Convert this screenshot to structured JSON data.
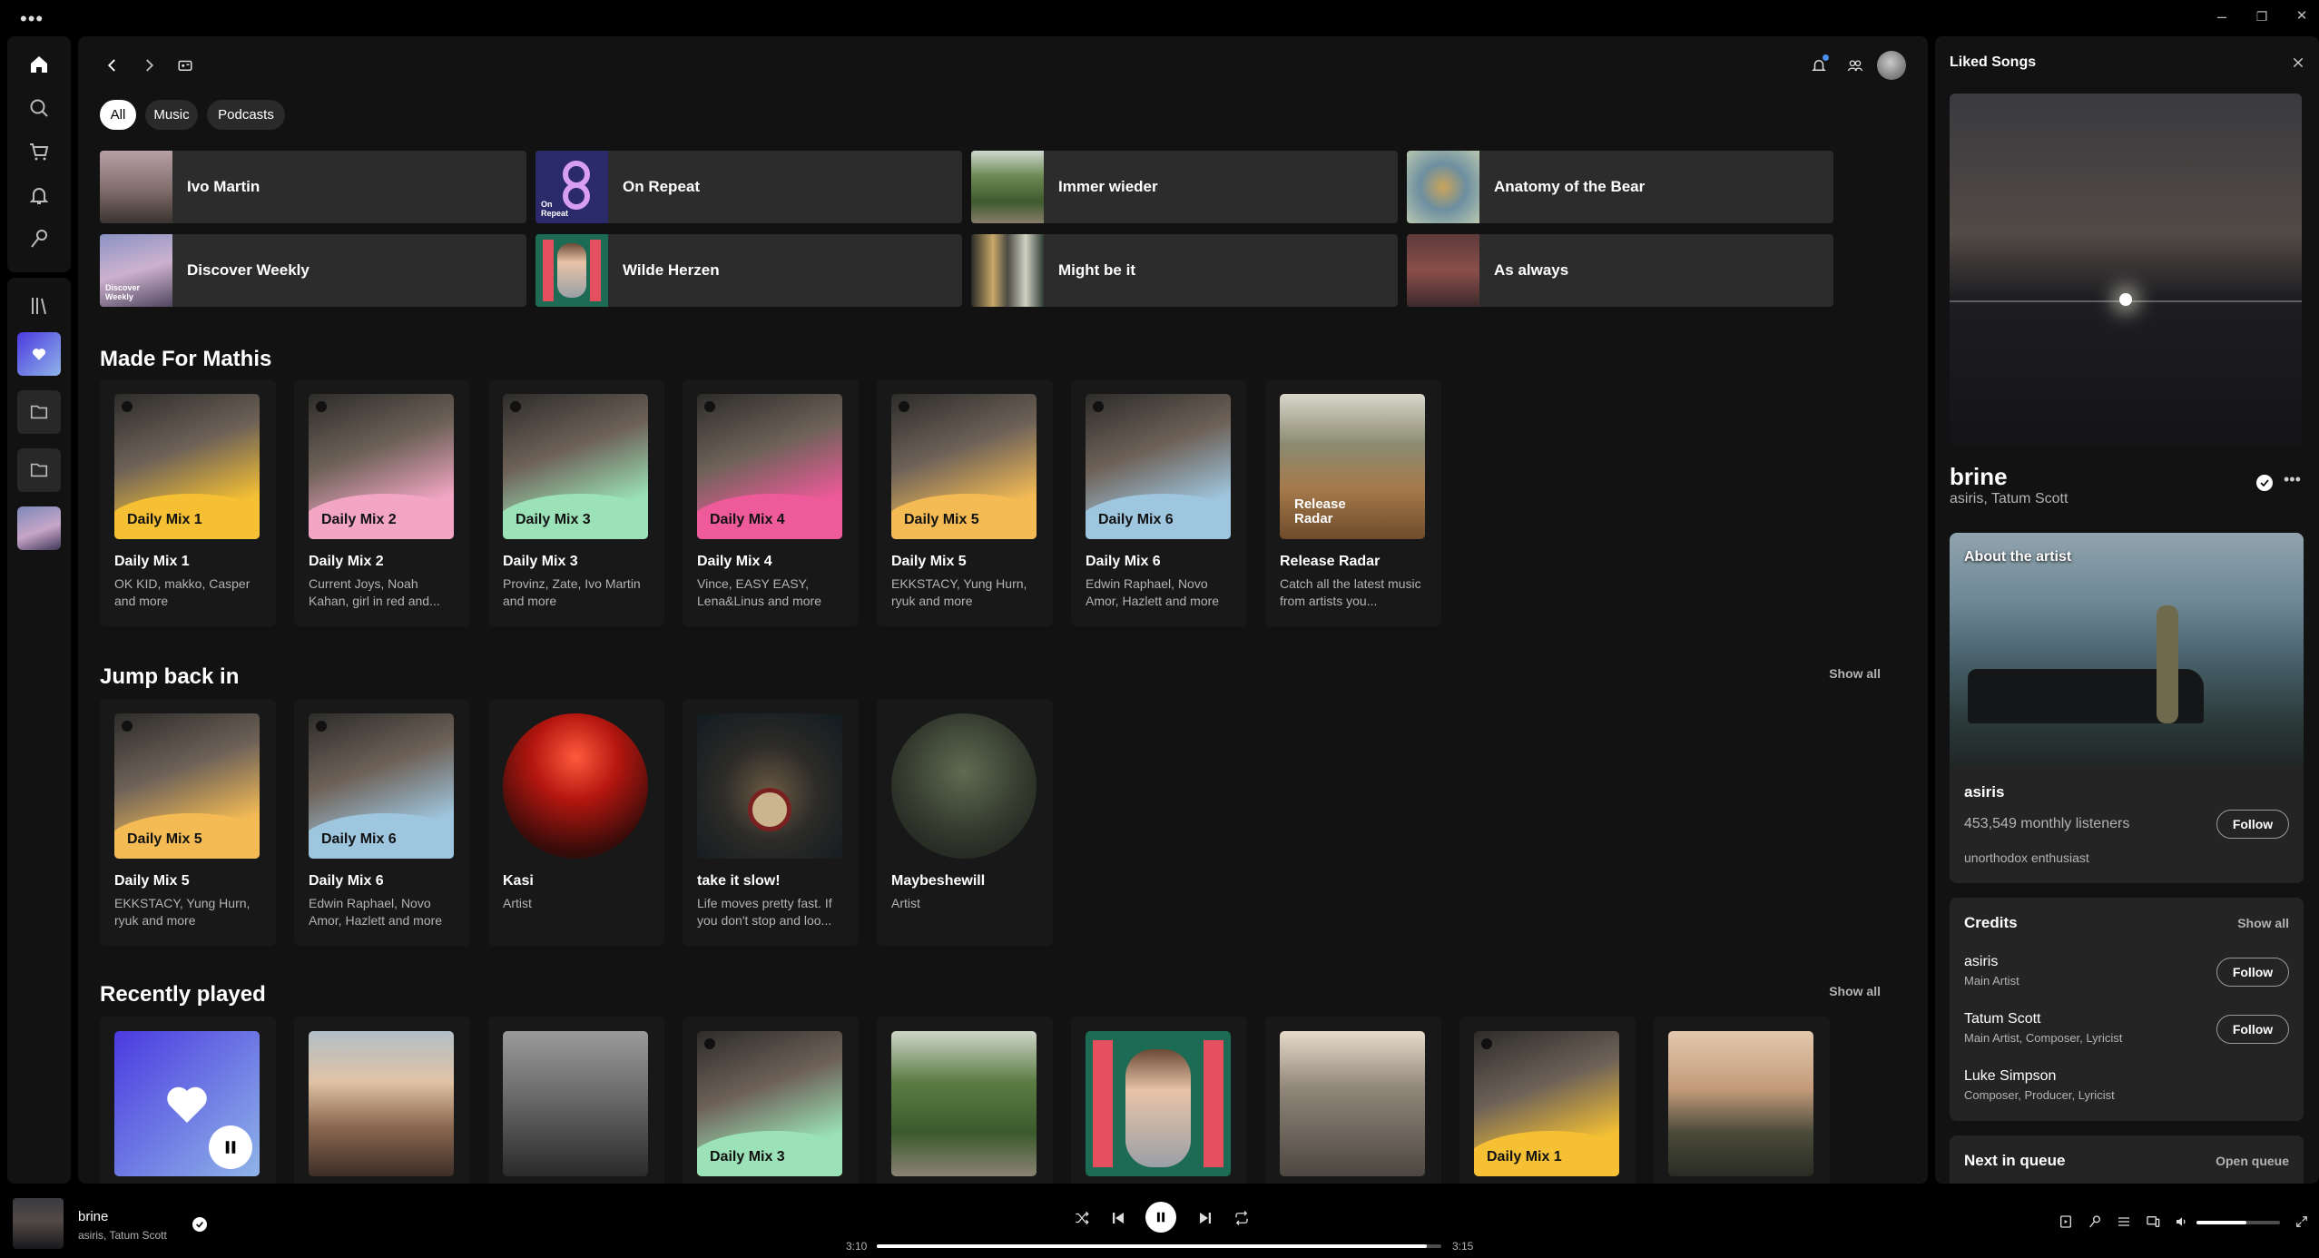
{
  "titlebar": {
    "menu": "•••",
    "minimize": "–",
    "restore": "❐",
    "close": "✕"
  },
  "filters": [
    "All",
    "Music",
    "Podcasts"
  ],
  "shortcuts": [
    {
      "label": "Ivo Martin"
    },
    {
      "label": "On Repeat",
      "art_text": "On Repeat"
    },
    {
      "label": "Immer wieder"
    },
    {
      "label": "Anatomy of the Bear"
    },
    {
      "label": "Discover Weekly",
      "art_text": "Discover Weekly"
    },
    {
      "label": "Wilde Herzen"
    },
    {
      "label": "Might be it"
    },
    {
      "label": "As always"
    }
  ],
  "made_for": {
    "title": "Made For Mathis",
    "cards": [
      {
        "title": "Daily Mix 1",
        "sub": "OK KID, makko, Casper and more",
        "art": "Daily Mix 1",
        "color": "#f5c033"
      },
      {
        "title": "Daily Mix 2",
        "sub": "Current Joys, Noah Kahan, girl in red and...",
        "art": "Daily Mix 2",
        "color": "#f3a6c4"
      },
      {
        "title": "Daily Mix 3",
        "sub": "Provinz, Zate, Ivo Martin and more",
        "art": "Daily Mix 3",
        "color": "#9be2b8"
      },
      {
        "title": "Daily Mix 4",
        "sub": "Vince, EASY EASY, Lena&Linus and more",
        "art": "Daily Mix 4",
        "color": "#ef5a9a"
      },
      {
        "title": "Daily Mix 5",
        "sub": "EKKSTACY, Yung Hurn, ryuk and more",
        "art": "Daily Mix 5",
        "color": "#f4bb55"
      },
      {
        "title": "Daily Mix 6",
        "sub": "Edwin Raphael, Novo Amor, Hazlett and more",
        "art": "Daily Mix 6",
        "color": "#9fc6df"
      },
      {
        "title": "Release Radar",
        "sub": "Catch all the latest music from artists you...",
        "art": "Release Radar",
        "color": "#b08a5a"
      }
    ]
  },
  "jump_back": {
    "title": "Jump back in",
    "show_all": "Show all",
    "cards": [
      {
        "title": "Daily Mix 5",
        "sub": "EKKSTACY, Yung Hurn, ryuk and more",
        "art": "Daily Mix 5",
        "color": "#f4bb55"
      },
      {
        "title": "Daily Mix 6",
        "sub": "Edwin Raphael, Novo Amor, Hazlett and more",
        "art": "Daily Mix 6",
        "color": "#9fc6df"
      },
      {
        "title": "Kasi",
        "sub": "Artist"
      },
      {
        "title": "take it slow!",
        "sub": "Life moves pretty fast. If you don't stop and loo..."
      },
      {
        "title": "Maybeshewill",
        "sub": "Artist"
      }
    ]
  },
  "recently": {
    "title": "Recently played",
    "show_all": "Show all",
    "art_labels": [
      "Daily Mix 3",
      "Daily Mix 1"
    ]
  },
  "right_panel": {
    "title": "Liked Songs",
    "song": "brine",
    "artists": "asiris, Tatum Scott",
    "about_label": "About the artist",
    "artist_name": "asiris",
    "listeners": "453,549 monthly listeners",
    "bio": "unorthodox enthusiast",
    "follow": "Follow",
    "credits_title": "Credits",
    "credits_show_all": "Show all",
    "credits": [
      {
        "name": "asiris",
        "role": "Main Artist",
        "follow": true
      },
      {
        "name": "Tatum Scott",
        "role": "Main Artist, Composer, Lyricist",
        "follow": true
      },
      {
        "name": "Luke Simpson",
        "role": "Composer, Producer, Lyricist",
        "follow": false
      }
    ],
    "queue_title": "Next in queue",
    "open_queue": "Open queue"
  },
  "player": {
    "song": "brine",
    "artists": "asiris, Tatum Scott",
    "elapsed": "3:10",
    "duration": "3:15",
    "progress": 0.974,
    "volume": 0.6
  },
  "colors": {
    "accent": "#1ed760",
    "liked_gradient_start": "#4b3ae0",
    "liked_gradient_end": "#8fb4e8"
  }
}
